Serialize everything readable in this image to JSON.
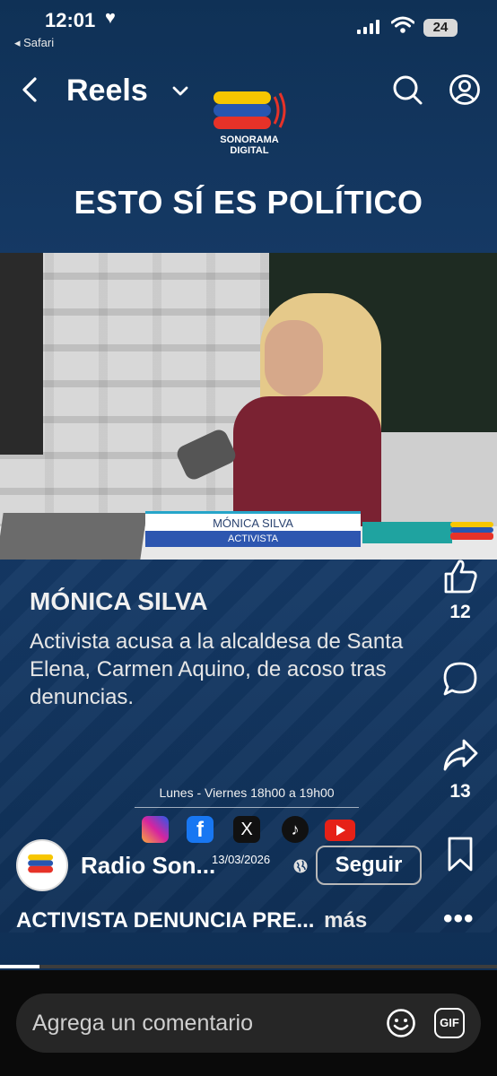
{
  "status_bar": {
    "time": "12:01",
    "heart_glyph": "♥",
    "back_app": "◂ Safari",
    "battery_level": "24"
  },
  "nav": {
    "title": "Reels",
    "icons": [
      "back-icon",
      "chevron-down-icon",
      "search-icon",
      "profile-icon"
    ]
  },
  "video": {
    "logo_line1": "SONORAMA",
    "logo_line2": "DIGITAL",
    "headline": "ESTO SÍ ES POLÍTICO",
    "lower_third_name": "MÓNICA SILVA",
    "lower_third_role": "ACTIVISTA",
    "caption_name": "MÓNICA SILVA",
    "caption_text": "Activista acusa a la alcaldesa de Santa Elena, Carmen Aquino, de acoso tras denuncias.",
    "schedule": "Lunes - Viernes 18h00 a 19h00",
    "social_icons": [
      "instagram-icon",
      "facebook-icon",
      "x-icon",
      "tiktok-icon",
      "youtube-icon"
    ],
    "facebook_glyph": "f",
    "x_glyph": "X",
    "tiktok_glyph": "♪"
  },
  "actions": {
    "like_count": "12",
    "share_count": "13"
  },
  "account": {
    "name": "Radio Son...",
    "date": "13/03/2026",
    "follow_label": "Seguir"
  },
  "caption": {
    "text": "ACTIVISTA DENUNCIA PRE...",
    "more_label": "más",
    "more_dots": "•••"
  },
  "progress": {
    "value_percent": 8
  },
  "composer": {
    "placeholder": "Agrega un comentario",
    "gif_label": "GIF"
  },
  "colors": {
    "brand_red": "#e63228",
    "brand_yellow": "#f7c600",
    "brand_blue": "#2756b0",
    "bg_blue": "#163a66"
  }
}
